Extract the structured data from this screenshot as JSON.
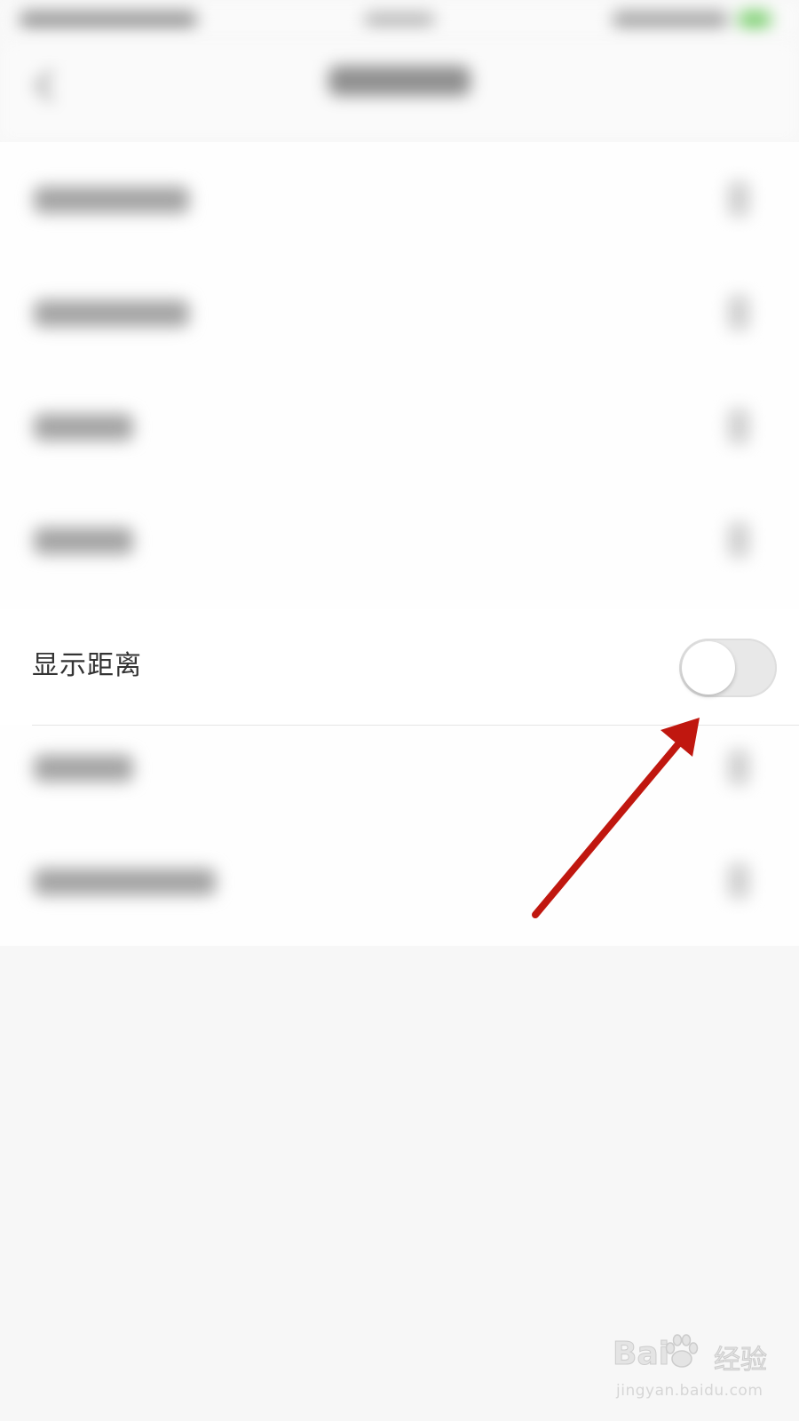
{
  "settings": {
    "show_distance_label": "显示距离",
    "show_distance_enabled": false
  },
  "watermark": {
    "logo": "Bai",
    "logo_suffix": "经验",
    "url": "jingyan.baidu.com"
  },
  "annotation": {
    "arrow_color": "#c0170f"
  },
  "colors": {
    "background": "#f7f7f7",
    "row_background": "#ffffff",
    "toggle_off_track": "#e8e8e8",
    "toggle_knob": "#ffffff"
  }
}
